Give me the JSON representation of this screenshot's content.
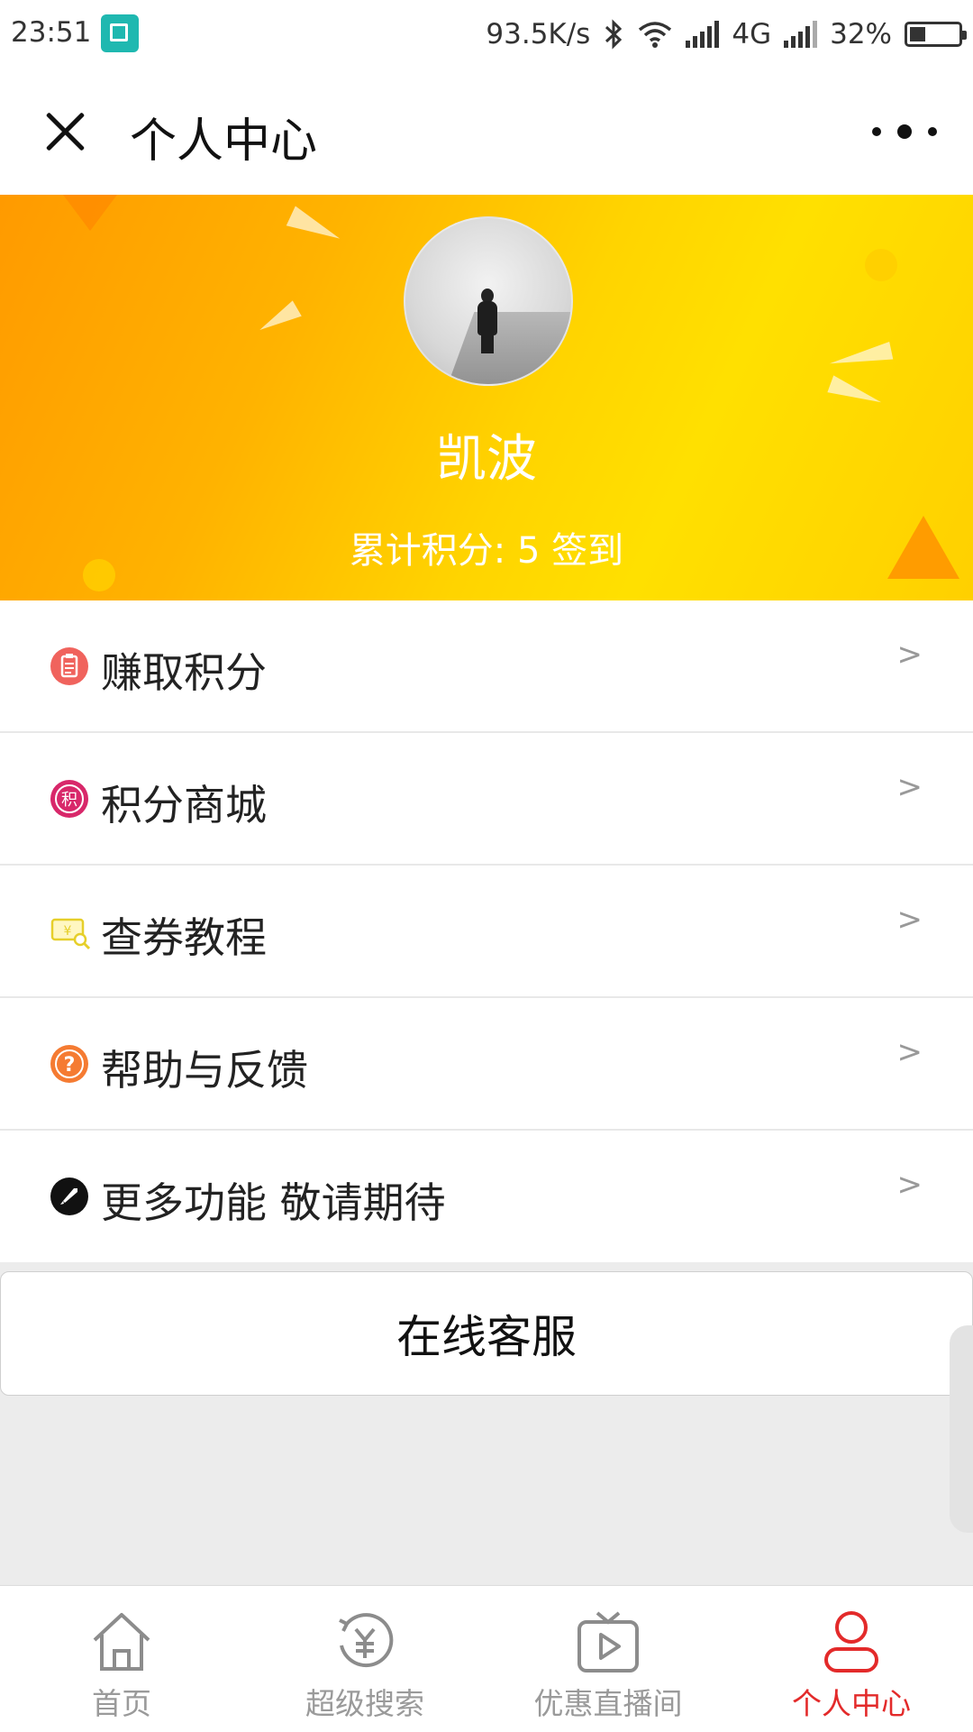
{
  "status_bar": {
    "time": "23:51",
    "net_speed": "93.5K/s",
    "network": "4G",
    "battery": "32%",
    "battery_level": 0.32
  },
  "nav": {
    "title": "个人中心",
    "close_icon": "close-icon",
    "more_icon": "more-dots-icon"
  },
  "profile": {
    "username": "凯波",
    "points_text": "累计积分: 5 签到"
  },
  "menu": [
    {
      "label": "赚取积分",
      "icon": "clipboard-icon",
      "color": "#f0635d",
      "arrow": ">"
    },
    {
      "label": "积分商城",
      "icon": "points-icon",
      "color": "#d8286a",
      "arrow": ">"
    },
    {
      "label": "查券教程",
      "icon": "coupon-search-icon",
      "color": "#e6cf2a",
      "arrow": ">"
    },
    {
      "label": "帮助与反馈",
      "icon": "help-icon",
      "color": "#f57b32",
      "arrow": ">"
    },
    {
      "label": "更多功能 敬请期待",
      "icon": "rocket-icon",
      "color": "#111111",
      "arrow": ">"
    }
  ],
  "service_button": "在线客服",
  "tabs": [
    {
      "label": "首页",
      "icon": "home-icon",
      "active": false
    },
    {
      "label": "超级搜索",
      "icon": "yuan-search-icon",
      "active": false
    },
    {
      "label": "优惠直播间",
      "icon": "tv-play-icon",
      "active": false
    },
    {
      "label": "个人中心",
      "icon": "user-icon",
      "active": true
    }
  ],
  "colors": {
    "accent": "#e32a2a",
    "banner_start": "#ff9a00",
    "banner_end": "#ffe000",
    "tab_inactive": "#9a9a9a"
  }
}
